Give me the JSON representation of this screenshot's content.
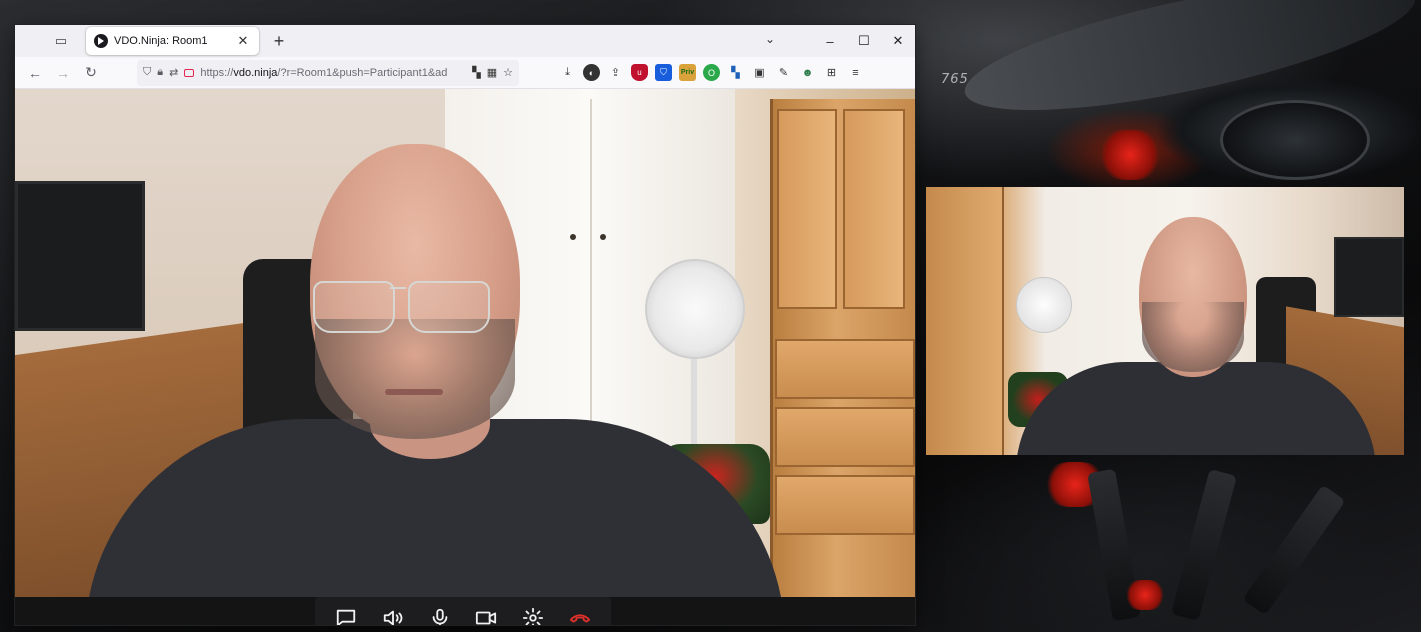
{
  "browser": {
    "tab": {
      "title": "VDO.Ninja: Room1"
    },
    "url": {
      "prefix": "https://",
      "host": "vdo.ninja",
      "path": "/?r=Room1&push=Participant1&ad"
    },
    "window_controls": {
      "minimize": "–",
      "maximize": "☐",
      "close": "✕"
    }
  },
  "call": {
    "controls": [
      {
        "name": "chat-button",
        "icon": "chat-icon"
      },
      {
        "name": "speaker-button",
        "icon": "speaker-icon"
      },
      {
        "name": "microphone-button",
        "icon": "microphone-icon"
      },
      {
        "name": "camera-button",
        "icon": "camera-icon"
      },
      {
        "name": "settings-button",
        "icon": "gear-icon"
      },
      {
        "name": "hangup-button",
        "icon": "hangup-icon"
      }
    ],
    "hangup_color": "#e0302a"
  },
  "desktop": {
    "wallpaper_badge": "765"
  },
  "colors": {
    "tabbar": "#f0f0f4",
    "navbar": "#f9f9fb",
    "control_bar": "#1d1d20"
  }
}
